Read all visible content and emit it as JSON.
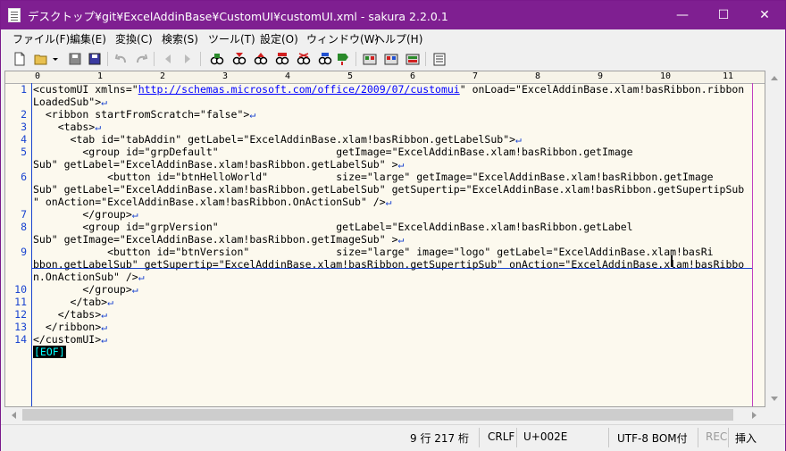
{
  "window": {
    "title": "デスクトップ¥git¥ExcelAddinBase¥CustomUI¥customUI.xml - sakura 2.2.0.1",
    "minimize": "—",
    "maximize": "☐",
    "close": "✕"
  },
  "menu": [
    "ファイル(F)",
    "編集(E)",
    "変換(C)",
    "検索(S)",
    "ツール(T)",
    "設定(O)",
    "ウィンドウ(W)",
    "ヘルプ(H)"
  ],
  "ruler": [
    "0",
    "1",
    "2",
    "3",
    "4",
    "5",
    "6",
    "7",
    "8",
    "9",
    "10",
    "11"
  ],
  "line_numbers": [
    {
      "n": "1",
      "row": 0
    },
    {
      "n": "2",
      "row": 2
    },
    {
      "n": "3",
      "row": 3
    },
    {
      "n": "4",
      "row": 4
    },
    {
      "n": "5",
      "row": 5
    },
    {
      "n": "6",
      "row": 7
    },
    {
      "n": "7",
      "row": 10
    },
    {
      "n": "8",
      "row": 11
    },
    {
      "n": "9",
      "row": 13
    },
    {
      "n": "10",
      "row": 16
    },
    {
      "n": "11",
      "row": 17
    },
    {
      "n": "12",
      "row": 18
    },
    {
      "n": "13",
      "row": 19
    },
    {
      "n": "14",
      "row": 20
    }
  ],
  "code": {
    "l1a_pre": "<customUI xmlns=\"",
    "l1a_url": "http://schemas.microsoft.com/office/2009/07/customui",
    "l1a_post": "\" onLoad=\"ExcelAddinBase.xlam!basRibbon.ribbon",
    "l1b": "LoadedSub\">",
    "l2": "  <ribbon startFromScratch=\"false\">",
    "l3": "    <tabs>",
    "l4": "      <tab id=\"tabAddin\" getLabel=\"ExcelAddinBase.xlam!basRibbon.getLabelSub\">",
    "l5a": "        <group id=\"grpDefault\"                   getImage=\"ExcelAddinBase.xlam!basRibbon.getImage",
    "l5b": "Sub\" getLabel=\"ExcelAddinBase.xlam!basRibbon.getLabelSub\" >",
    "l6a": "            <button id=\"btnHelloWorld\"           size=\"large\" getImage=\"ExcelAddinBase.xlam!basRibbon.getImage",
    "l6b": "Sub\" getLabel=\"ExcelAddinBase.xlam!basRibbon.getLabelSub\" getSupertip=\"ExcelAddinBase.xlam!basRibbon.getSupertipSub",
    "l6c": "\" onAction=\"ExcelAddinBase.xlam!basRibbon.OnActionSub\" />",
    "l7": "        </group>",
    "l8a": "        <group id=\"grpVersion\"                   getLabel=\"ExcelAddinBase.xlam!basRibbon.getLabel",
    "l8b": "Sub\" getImage=\"ExcelAddinBase.xlam!basRibbon.getImageSub\" >",
    "l9a": "            <button id=\"btnVersion\"              size=\"large\" image=\"logo\" getLabel=\"ExcelAddinBase.xlam!basRi",
    "l9b": "bbon.getLabelSub\" getSupertip=\"ExcelAddinBase.xlam!basRibbon.getSupertipSub\" onAction=\"ExcelAddinBase.xlam!basRibbo",
    "l9c": "n.OnActionSub\" />",
    "l10": "        </group>",
    "l11": "      </tab>",
    "l12": "    </tabs>",
    "l13": "  </ribbon>",
    "l14": "</customUI>",
    "eol": "↵",
    "eof": "[EOF]"
  },
  "status": {
    "position": "9 行 217 桁",
    "newline": "CRLF",
    "codepoint": "U+002E",
    "encoding": "UTF-8 BOM付",
    "rec": "REC",
    "mode": "挿入"
  },
  "colors": {
    "titlebar": "#7f1f91",
    "editor_bg": "#fcf9ee",
    "line_number": "#1a44d0",
    "url": "#0000ff",
    "eof_fg": "#00ffff"
  }
}
